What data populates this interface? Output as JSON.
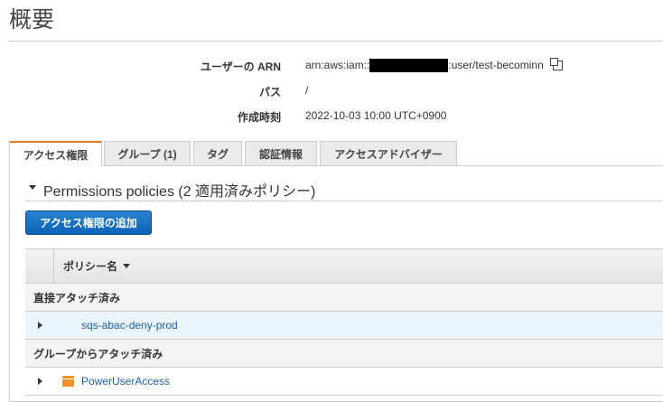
{
  "title": "概要",
  "summary": {
    "arn_label": "ユーザーの ARN",
    "arn_prefix": "arn:aws:iam::",
    "arn_suffix": ":user/test-becominn",
    "path_label": "パス",
    "path_value": "/",
    "created_label": "作成時刻",
    "created_value": "2022-10-03 10:00 UTC+0900"
  },
  "tabs": [
    "アクセス権限",
    "グループ (1)",
    "タグ",
    "認証情報",
    "アクセスアドバイザー"
  ],
  "section_title": "Permissions policies (2 適用済みポリシー)",
  "add_button": "アクセス権限の追加",
  "table": {
    "column": "ポリシー名",
    "groups": [
      {
        "label": "直接アタッチ済み",
        "policy": "sqs-abac-deny-prod"
      },
      {
        "label": "グループからアタッチ済み",
        "policy": "PowerUserAccess"
      }
    ]
  },
  "colors": {
    "accent": "#e07b27",
    "link": "#1a5fa8",
    "button": "#0b64b5"
  }
}
